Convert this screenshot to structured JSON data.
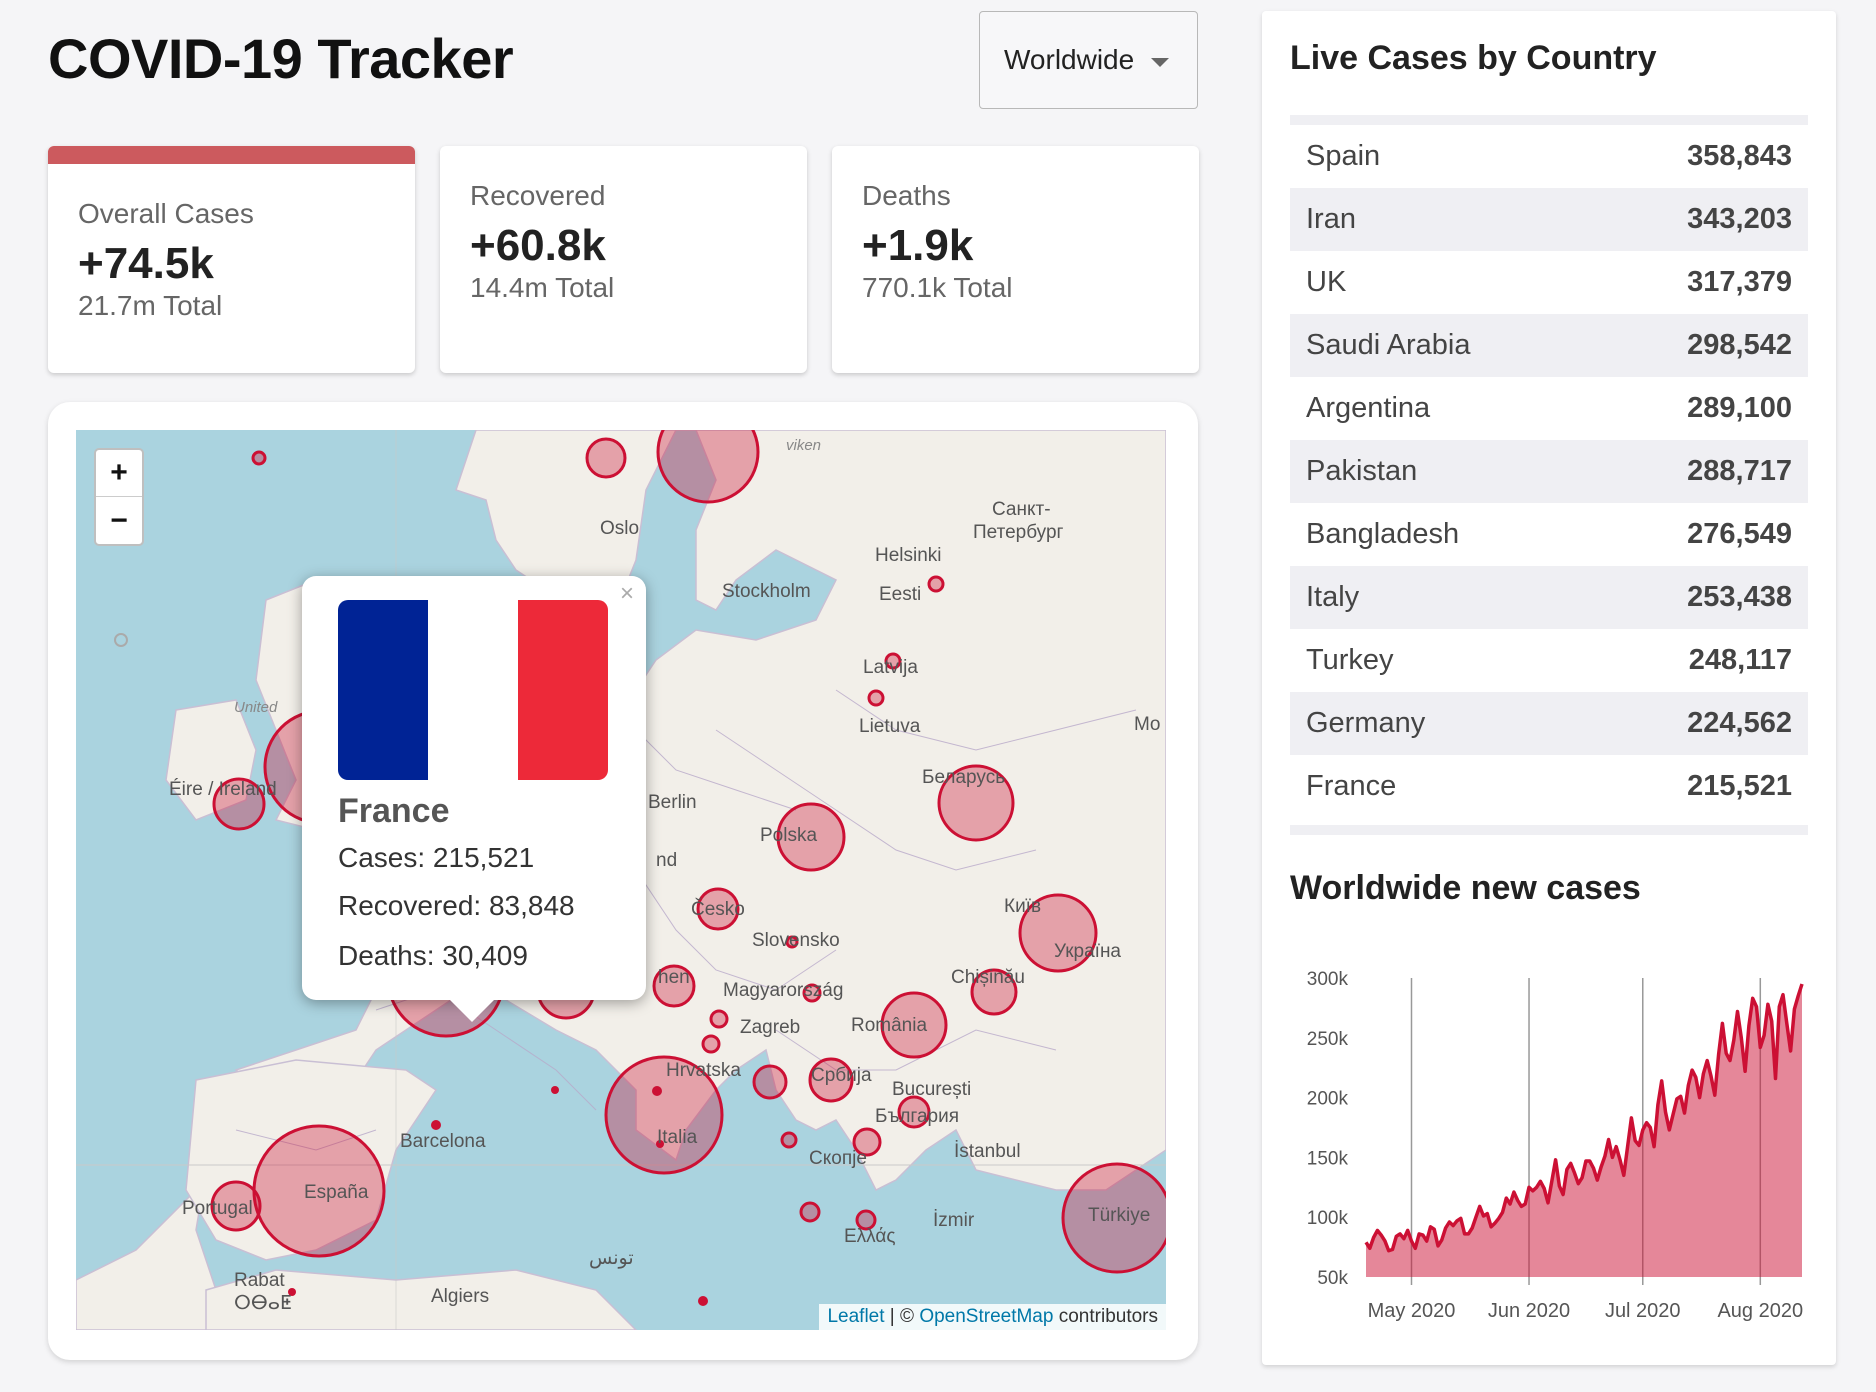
{
  "header": {
    "title": "COVID-19 Tracker"
  },
  "country_select": {
    "value": "Worldwide"
  },
  "stats": [
    {
      "title": "Overall Cases",
      "delta": "+74.5k",
      "total": "21.7m Total",
      "active": true
    },
    {
      "title": "Recovered",
      "delta": "+60.8k",
      "total": "14.4m Total",
      "active": false
    },
    {
      "title": "Deaths",
      "delta": "+1.9k",
      "total": "770.1k Total",
      "active": false
    }
  ],
  "map": {
    "zoom_in": "+",
    "zoom_out": "−",
    "labels": {
      "oslo": "Oslo",
      "stockholm": "Stockholm",
      "helsinki": "Helsinki",
      "spb_1": "Санкт-",
      "spb_2": "Петербург",
      "eesti": "Eesti",
      "latvija": "Latvija",
      "lietuva": "Lietuva",
      "united": "United",
      "eire": "Éire / Ireland",
      "berlin": "Berlin",
      "polska": "Polska",
      "belarus": "Беларусь",
      "cesko": "Česko",
      "slovensko": "Slovensko",
      "kyiv": "Київ",
      "ukraina": "Україна",
      "magyarorszag": "Magyarország",
      "zagreb": "Zagreb",
      "romania": "România",
      "chisinau": "Chișinău",
      "hrvatska": "Hrvatska",
      "srbija": "Србија",
      "bucuresti": "București",
      "bulgaria": "България",
      "barcelona": "Barcelona",
      "espana": "España",
      "portugal": "Portugal",
      "italia": "Italia",
      "skopje": "Скопје",
      "istanbul": "İstanbul",
      "izmir": "İzmir",
      "turkiye": "Türkiye",
      "ellas": "Ελλάς",
      "rabat": "Rabat",
      "rabat_2": "ⵔⴱⴰⵟ",
      "algiers": "Algiers",
      "tunis": "تونس",
      "moscow": "Mo",
      "viken": "viken",
      "nd": "nd",
      "hen": "hen"
    },
    "popup": {
      "close": "×",
      "country": "France",
      "cases": "Cases: 215,521",
      "recovered": "Recovered: 83,848",
      "deaths": "Deaths: 30,409",
      "flag_colors": [
        "#002395",
        "#ffffff",
        "#ed2939"
      ]
    },
    "attribution": {
      "leaflet": "Leaflet",
      "sep": " | © ",
      "osm": "OpenStreetMap",
      "contrib": " contributors"
    }
  },
  "live_cases": {
    "title": "Live Cases by Country",
    "rows": [
      {
        "country": "Spain",
        "cases": "358,843"
      },
      {
        "country": "Iran",
        "cases": "343,203"
      },
      {
        "country": "UK",
        "cases": "317,379"
      },
      {
        "country": "Saudi Arabia",
        "cases": "298,542"
      },
      {
        "country": "Argentina",
        "cases": "289,100"
      },
      {
        "country": "Pakistan",
        "cases": "288,717"
      },
      {
        "country": "Bangladesh",
        "cases": "276,549"
      },
      {
        "country": "Italy",
        "cases": "253,438"
      },
      {
        "country": "Turkey",
        "cases": "248,117"
      },
      {
        "country": "Germany",
        "cases": "224,562"
      },
      {
        "country": "France",
        "cases": "215,521"
      }
    ]
  },
  "chart_title": "Worldwide new cases",
  "chart_data": {
    "type": "area",
    "title": "Worldwide new cases",
    "xlabel": "",
    "ylabel": "",
    "ylim": [
      50000,
      300000
    ],
    "yticks": [
      50000,
      100000,
      150000,
      200000,
      250000,
      300000
    ],
    "ytick_labels": [
      "50k",
      "100k",
      "150k",
      "200k",
      "250k",
      "300k"
    ],
    "xticks": [
      "May 2020",
      "Jun 2020",
      "Jul 2020",
      "Aug 2020"
    ],
    "xtick_days": [
      12,
      43,
      73,
      104
    ],
    "grid": "vertical",
    "color": "#cc1034",
    "fill": "rgba(204,16,52,0.5)",
    "series": [
      {
        "x_start": "2020-04-19",
        "values": [
          79000,
          74000,
          83000,
          89000,
          85000,
          80000,
          72000,
          73000,
          84000,
          86000,
          82000,
          89000,
          80000,
          74000,
          86000,
          85000,
          80000,
          92000,
          90000,
          76000,
          81000,
          91000,
          96000,
          93000,
          97000,
          99000,
          86000,
          86000,
          91000,
          100000,
          109000,
          101000,
          103000,
          92000,
          95000,
          99000,
          104000,
          116000,
          111000,
          121000,
          114000,
          109000,
          111000,
          125000,
          122000,
          125000,
          130000,
          124000,
          112000,
          130000,
          148000,
          126000,
          119000,
          140000,
          145000,
          137000,
          128000,
          133000,
          147000,
          147000,
          141000,
          131000,
          142000,
          151000,
          165000,
          150000,
          159000,
          148000,
          135000,
          159000,
          183000,
          164000,
          160000,
          173000,
          179000,
          175000,
          159000,
          194000,
          214000,
          188000,
          173000,
          186000,
          199000,
          201000,
          187000,
          210000,
          223000,
          217000,
          200000,
          220000,
          231000,
          218000,
          202000,
          236000,
          262000,
          237000,
          231000,
          248000,
          272000,
          250000,
          222000,
          260000,
          283000,
          276000,
          242000,
          252000,
          278000,
          264000,
          216000,
          276000,
          286000,
          262000,
          239000,
          274000,
          285000,
          295000
        ]
      }
    ]
  }
}
